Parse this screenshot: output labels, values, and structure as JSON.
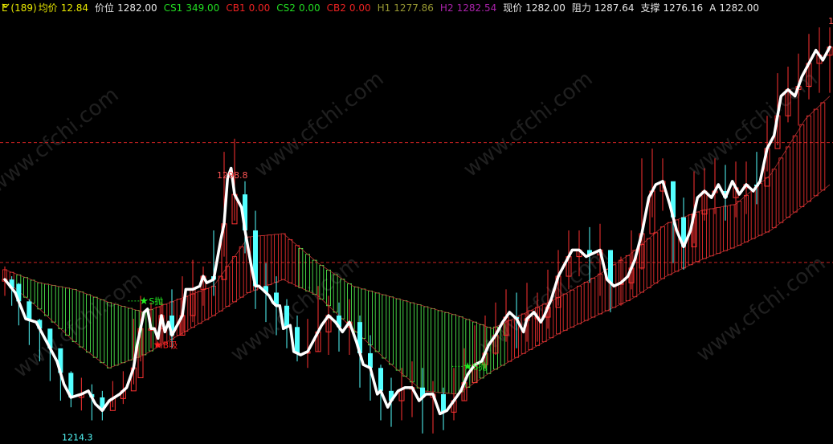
{
  "header": {
    "period": "E (189)",
    "items": [
      {
        "label": "均价",
        "value": "12.84",
        "color": "#e8e800"
      },
      {
        "label": "价位",
        "value": "1282.00",
        "color": "#e8e8e8"
      },
      {
        "label": "CS1",
        "value": "349.00",
        "color": "#22dd22"
      },
      {
        "label": "CB1",
        "value": "0.00",
        "color": "#ee2222"
      },
      {
        "label": "CS2",
        "value": "0.00",
        "color": "#22dd22"
      },
      {
        "label": "CB2",
        "value": "0.00",
        "color": "#ee2222"
      },
      {
        "label": "H1",
        "value": "1277.86",
        "color": "#999933"
      },
      {
        "label": "H2",
        "value": "1282.54",
        "color": "#aa22aa"
      },
      {
        "label": "现价",
        "value": "1282.00",
        "color": "#e8e8e8"
      },
      {
        "label": "阻力",
        "value": "1287.64",
        "color": "#e8e8e8"
      },
      {
        "label": "支撑",
        "value": "1276.16",
        "color": "#e8e8e8"
      },
      {
        "label": "A",
        "value": "1282.00",
        "color": "#e8e8e8"
      }
    ]
  },
  "watermark": "www.cfchi.com",
  "chart_data": {
    "type": "candlestick",
    "high_label": "1298.8",
    "low_label": "1214.3",
    "corner_label": "1",
    "signals": [
      {
        "text": "S抛",
        "kind": "sell"
      },
      {
        "text": "B吸",
        "kind": "buy"
      },
      {
        "text": "S抛",
        "kind": "sell"
      }
    ],
    "colors": {
      "up_candle": "#ff3232",
      "down_candle": "#54ffff",
      "main_line": "#ffffff",
      "bull_band": "#ff3232",
      "bear_band": "#54ff54",
      "guide_line": "#cc2222"
    },
    "ylim": [
      1208,
      1335
    ],
    "reference_levels": [
      1298.8,
      1262.2
    ],
    "price_line": [
      [
        0,
        1257
      ],
      [
        3,
        1253
      ],
      [
        6,
        1245
      ],
      [
        9,
        1244
      ],
      [
        12,
        1238
      ],
      [
        15,
        1232
      ],
      [
        17,
        1225
      ],
      [
        19,
        1221
      ],
      [
        22,
        1222
      ],
      [
        24,
        1223
      ],
      [
        26,
        1219
      ],
      [
        28,
        1217
      ],
      [
        30,
        1220
      ],
      [
        33,
        1222
      ],
      [
        35,
        1224
      ],
      [
        37,
        1230
      ],
      [
        38,
        1237
      ],
      [
        40,
        1247
      ],
      [
        41,
        1248
      ],
      [
        42,
        1242
      ],
      [
        43,
        1242
      ],
      [
        44,
        1239
      ],
      [
        45,
        1246
      ],
      [
        46,
        1241
      ],
      [
        47,
        1244
      ],
      [
        48,
        1240
      ],
      [
        50,
        1244
      ],
      [
        51,
        1246
      ],
      [
        52,
        1254
      ],
      [
        54,
        1254
      ],
      [
        56,
        1255
      ],
      [
        57,
        1258
      ],
      [
        58,
        1256
      ],
      [
        60,
        1257
      ],
      [
        62,
        1269
      ],
      [
        63,
        1274
      ],
      [
        64,
        1288
      ],
      [
        65,
        1291
      ],
      [
        66,
        1283
      ],
      [
        68,
        1279
      ],
      [
        69,
        1272
      ],
      [
        70,
        1266
      ],
      [
        71,
        1260
      ],
      [
        72,
        1255
      ],
      [
        73,
        1255
      ],
      [
        74,
        1254
      ],
      [
        76,
        1252
      ],
      [
        77,
        1250
      ],
      [
        78,
        1249
      ],
      [
        79,
        1249
      ],
      [
        80,
        1242
      ],
      [
        82,
        1243
      ],
      [
        83,
        1235
      ],
      [
        85,
        1234
      ],
      [
        87,
        1235
      ],
      [
        89,
        1239
      ],
      [
        91,
        1243
      ],
      [
        93,
        1246
      ],
      [
        95,
        1244
      ],
      [
        97,
        1241
      ],
      [
        99,
        1244
      ],
      [
        101,
        1238
      ],
      [
        103,
        1231
      ],
      [
        105,
        1230
      ],
      [
        107,
        1222
      ],
      [
        108,
        1223
      ],
      [
        110,
        1218
      ],
      [
        111,
        1220
      ],
      [
        113,
        1223
      ],
      [
        115,
        1224
      ],
      [
        117,
        1224
      ],
      [
        119,
        1220
      ],
      [
        121,
        1222
      ],
      [
        123,
        1222
      ],
      [
        125,
        1216
      ],
      [
        127,
        1217
      ],
      [
        129,
        1220
      ],
      [
        131,
        1223
      ],
      [
        133,
        1228
      ],
      [
        135,
        1231
      ],
      [
        137,
        1232
      ],
      [
        139,
        1237
      ],
      [
        141,
        1240
      ],
      [
        143,
        1244
      ],
      [
        145,
        1247
      ],
      [
        147,
        1245
      ],
      [
        149,
        1241
      ],
      [
        150,
        1245
      ],
      [
        152,
        1247
      ],
      [
        154,
        1244
      ],
      [
        155,
        1246
      ],
      [
        157,
        1251
      ],
      [
        159,
        1258
      ],
      [
        161,
        1262
      ],
      [
        163,
        1266
      ],
      [
        165,
        1266
      ],
      [
        167,
        1264
      ],
      [
        169,
        1265
      ],
      [
        171,
        1266
      ],
      [
        173,
        1257
      ],
      [
        175,
        1255
      ],
      [
        177,
        1256
      ],
      [
        179,
        1258
      ],
      [
        181,
        1263
      ],
      [
        183,
        1271
      ],
      [
        185,
        1282
      ],
      [
        187,
        1286
      ],
      [
        189,
        1287
      ],
      [
        191,
        1280
      ],
      [
        193,
        1272
      ],
      [
        195,
        1267
      ],
      [
        197,
        1272
      ],
      [
        199,
        1282
      ],
      [
        201,
        1284
      ],
      [
        203,
        1282
      ],
      [
        205,
        1286
      ],
      [
        207,
        1282
      ],
      [
        209,
        1287
      ],
      [
        211,
        1283
      ],
      [
        213,
        1286
      ],
      [
        215,
        1284
      ],
      [
        217,
        1287
      ],
      [
        219,
        1297
      ],
      [
        221,
        1301
      ],
      [
        223,
        1313
      ],
      [
        225,
        1315
      ],
      [
        227,
        1313
      ],
      [
        229,
        1319
      ],
      [
        231,
        1323
      ],
      [
        233,
        1327
      ],
      [
        235,
        1324
      ],
      [
        237,
        1328
      ]
    ],
    "wick_ranges": [
      [
        0,
        1252,
        1261
      ],
      [
        2,
        1249,
        1258
      ],
      [
        4,
        1243,
        1256
      ],
      [
        7,
        1237,
        1251
      ],
      [
        10,
        1232,
        1245
      ],
      [
        13,
        1226,
        1240
      ],
      [
        16,
        1220,
        1233
      ],
      [
        19,
        1218,
        1229
      ],
      [
        22,
        1217,
        1227
      ],
      [
        25,
        1214,
        1225
      ],
      [
        28,
        1214,
        1223
      ],
      [
        31,
        1218,
        1226
      ],
      [
        34,
        1219,
        1229
      ],
      [
        37,
        1225,
        1245
      ],
      [
        39,
        1232,
        1252
      ],
      [
        42,
        1236,
        1250
      ],
      [
        45,
        1236,
        1250
      ],
      [
        48,
        1236,
        1254
      ],
      [
        51,
        1240,
        1258
      ],
      [
        54,
        1244,
        1263
      ],
      [
        57,
        1249,
        1261
      ],
      [
        60,
        1252,
        1272
      ],
      [
        63,
        1264,
        1296
      ],
      [
        66,
        1275,
        1300
      ],
      [
        69,
        1265,
        1287
      ],
      [
        72,
        1248,
        1278
      ],
      [
        75,
        1244,
        1262
      ],
      [
        78,
        1240,
        1258
      ],
      [
        81,
        1236,
        1251
      ],
      [
        84,
        1232,
        1246
      ],
      [
        87,
        1230,
        1245
      ],
      [
        90,
        1235,
        1255
      ],
      [
        93,
        1234,
        1252
      ],
      [
        96,
        1235,
        1250
      ],
      [
        99,
        1234,
        1251
      ],
      [
        102,
        1224,
        1246
      ],
      [
        105,
        1220,
        1240
      ],
      [
        108,
        1214,
        1231
      ],
      [
        111,
        1212,
        1227
      ],
      [
        114,
        1214,
        1230
      ],
      [
        117,
        1215,
        1232
      ],
      [
        120,
        1210,
        1230
      ],
      [
        123,
        1210,
        1226
      ],
      [
        126,
        1211,
        1224
      ],
      [
        129,
        1214,
        1230
      ],
      [
        132,
        1220,
        1236
      ],
      [
        135,
        1226,
        1243
      ],
      [
        138,
        1230,
        1246
      ],
      [
        141,
        1234,
        1250
      ],
      [
        144,
        1238,
        1254
      ],
      [
        147,
        1236,
        1253
      ],
      [
        150,
        1238,
        1256
      ],
      [
        153,
        1238,
        1253
      ],
      [
        156,
        1242,
        1260
      ],
      [
        159,
        1249,
        1266
      ],
      [
        162,
        1254,
        1272
      ],
      [
        165,
        1258,
        1272
      ],
      [
        168,
        1256,
        1273
      ],
      [
        171,
        1252,
        1274
      ],
      [
        174,
        1247,
        1264
      ],
      [
        177,
        1249,
        1264
      ],
      [
        180,
        1254,
        1272
      ],
      [
        183,
        1260,
        1294
      ],
      [
        186,
        1276,
        1297
      ],
      [
        189,
        1278,
        1294
      ],
      [
        192,
        1262,
        1286
      ],
      [
        195,
        1260,
        1282
      ],
      [
        198,
        1268,
        1290
      ],
      [
        201,
        1275,
        1291
      ],
      [
        204,
        1277,
        1294
      ],
      [
        207,
        1275,
        1292
      ],
      [
        210,
        1276,
        1293
      ],
      [
        213,
        1277,
        1293
      ],
      [
        216,
        1280,
        1296
      ],
      [
        219,
        1290,
        1307
      ],
      [
        222,
        1298,
        1320
      ],
      [
        225,
        1305,
        1322
      ],
      [
        228,
        1304,
        1326
      ],
      [
        231,
        1312,
        1332
      ],
      [
        234,
        1314,
        1334
      ],
      [
        237,
        1314,
        1334
      ]
    ],
    "bands": {
      "upper_line": [
        [
          0,
          1260
        ],
        [
          10,
          1256
        ],
        [
          20,
          1254
        ],
        [
          30,
          1250
        ],
        [
          40,
          1247
        ],
        [
          50,
          1251
        ],
        [
          60,
          1255
        ],
        [
          70,
          1270
        ],
        [
          80,
          1271
        ],
        [
          90,
          1262
        ],
        [
          100,
          1255
        ],
        [
          110,
          1252
        ],
        [
          120,
          1249
        ],
        [
          130,
          1246
        ],
        [
          140,
          1242
        ],
        [
          150,
          1247
        ],
        [
          160,
          1252
        ],
        [
          170,
          1258
        ],
        [
          180,
          1265
        ],
        [
          190,
          1274
        ],
        [
          200,
          1278
        ],
        [
          210,
          1280
        ],
        [
          220,
          1289
        ],
        [
          230,
          1306
        ],
        [
          237,
          1313
        ]
      ],
      "lower_line": [
        [
          0,
          1257
        ],
        [
          10,
          1248
        ],
        [
          20,
          1238
        ],
        [
          30,
          1230
        ],
        [
          40,
          1234
        ],
        [
          50,
          1240
        ],
        [
          60,
          1246
        ],
        [
          70,
          1253
        ],
        [
          80,
          1257
        ],
        [
          90,
          1252
        ],
        [
          100,
          1242
        ],
        [
          110,
          1232
        ],
        [
          120,
          1223
        ],
        [
          130,
          1222
        ],
        [
          140,
          1229
        ],
        [
          150,
          1235
        ],
        [
          160,
          1241
        ],
        [
          170,
          1246
        ],
        [
          180,
          1251
        ],
        [
          190,
          1258
        ],
        [
          200,
          1263
        ],
        [
          210,
          1267
        ],
        [
          220,
          1272
        ],
        [
          230,
          1280
        ],
        [
          237,
          1286
        ]
      ],
      "segments": [
        {
          "from": 0,
          "to": 4,
          "kind": "bull"
        },
        {
          "from": 4,
          "to": 44,
          "kind": "bear"
        },
        {
          "from": 44,
          "to": 85,
          "kind": "bull"
        },
        {
          "from": 85,
          "to": 145,
          "kind": "bear"
        },
        {
          "from": 145,
          "to": 237,
          "kind": "bull"
        }
      ]
    },
    "x_count": 238,
    "high_point_index": 66,
    "low_point_index": 21
  }
}
